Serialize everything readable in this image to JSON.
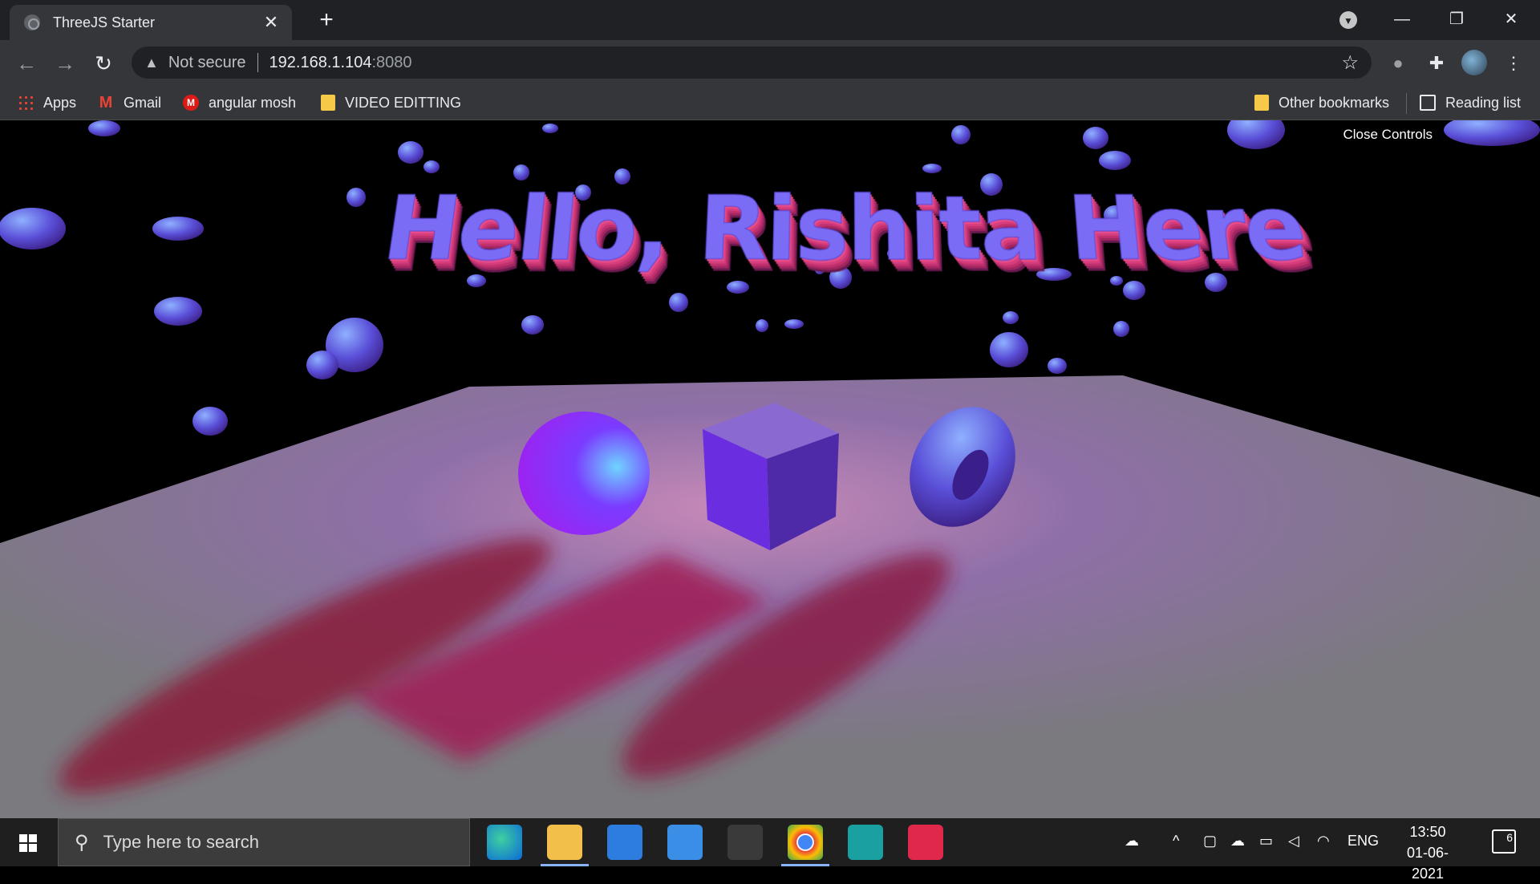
{
  "browser": {
    "tab_title": "ThreeJS Starter",
    "tab_close": "✕",
    "new_tab": "+",
    "minimize": "—",
    "restore": "❐",
    "close": "✕",
    "back": "←",
    "forward": "→",
    "reload": "↻",
    "security_icon": "▲",
    "security_text": "Not secure",
    "url_host": "192.168.1.104",
    "url_port": ":8080",
    "bookmark_star": "☆",
    "menu": "⋮"
  },
  "bookmarks": {
    "apps": "Apps",
    "gmail": "Gmail",
    "angular": "angular mosh",
    "video": "VIDEO EDITTING",
    "other": "Other bookmarks",
    "reading": "Reading list",
    "angular_icon_letter": "M",
    "gmail_icon_letter": "M"
  },
  "scene": {
    "close_controls": "Close Controls",
    "headline": "Hello, Rishita Here",
    "colors": {
      "floor": "#7c7b7f",
      "background": "#000000",
      "torus_light": "#7a8cff",
      "torus_dark": "#3a2aa0",
      "sphere": "#9b30ff",
      "cube": "#5b2bd0",
      "shadow": "#8a2040"
    }
  },
  "taskbar": {
    "search_placeholder": "Type here to search",
    "language": "ENG",
    "time": "13:50",
    "date": "01-06-2021",
    "notification_count": "6"
  }
}
